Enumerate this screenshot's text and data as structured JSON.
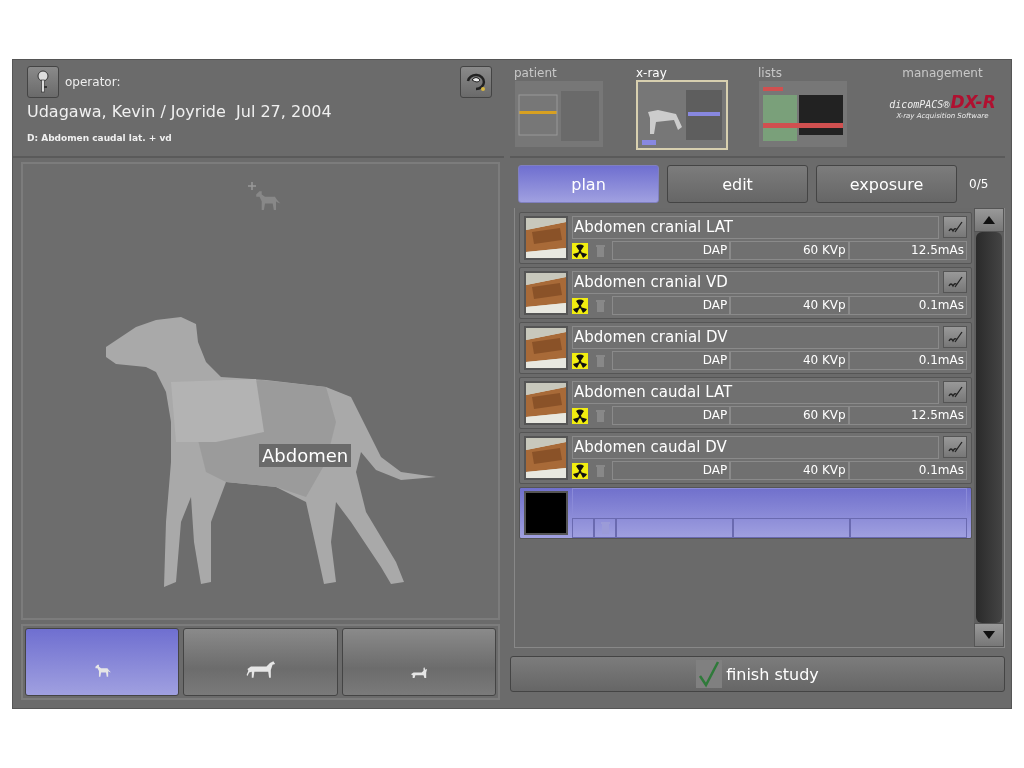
{
  "header": {
    "operator_label": "operator:",
    "patient_line": "Udagawa, Kevin / Joyride  Jul 27, 2004",
    "study": "D: Abdomen caudal lat. + vd"
  },
  "nav": [
    {
      "kind": "screen",
      "label": "patient",
      "selected": false
    },
    {
      "kind": "screen",
      "label": "x-ray",
      "selected": true
    },
    {
      "kind": "screen",
      "label": "lists",
      "selected": false
    },
    {
      "kind": "logo",
      "label": "management",
      "selected": false
    }
  ],
  "logo": {
    "brand": "dicomPACS®",
    "product": "DX-R",
    "tagline": "X-ray Acquisition Software"
  },
  "body_region": {
    "label": "Abdomen"
  },
  "species_tabs": [
    {
      "kind": "dog",
      "selected": true
    },
    {
      "kind": "horse",
      "selected": false
    },
    {
      "kind": "cat",
      "selected": false
    }
  ],
  "mode_tabs": [
    {
      "label": "plan",
      "selected": true
    },
    {
      "label": "edit",
      "selected": false
    },
    {
      "label": "exposure",
      "selected": false
    }
  ],
  "counter": "0/5",
  "exposures": [
    {
      "kind": "planned",
      "selected": false,
      "name": "Abdomen cranial LAT",
      "dap": "DAP",
      "kvp": "60 KVp",
      "mas": "12.5mAs"
    },
    {
      "kind": "planned",
      "selected": false,
      "name": "Abdomen cranial VD",
      "dap": "DAP",
      "kvp": "40 KVp",
      "mas": "0.1mAs"
    },
    {
      "kind": "planned",
      "selected": false,
      "name": "Abdomen cranial DV",
      "dap": "DAP",
      "kvp": "40 KVp",
      "mas": "0.1mAs"
    },
    {
      "kind": "planned",
      "selected": false,
      "name": "Abdomen caudal LAT",
      "dap": "DAP",
      "kvp": "60 KVp",
      "mas": "12.5mAs"
    },
    {
      "kind": "planned",
      "selected": false,
      "name": "Abdomen caudal DV",
      "dap": "DAP",
      "kvp": "40 KVp",
      "mas": "0.1mAs"
    },
    {
      "kind": "empty",
      "selected": true
    }
  ],
  "finish_button": {
    "label": "finish study"
  }
}
